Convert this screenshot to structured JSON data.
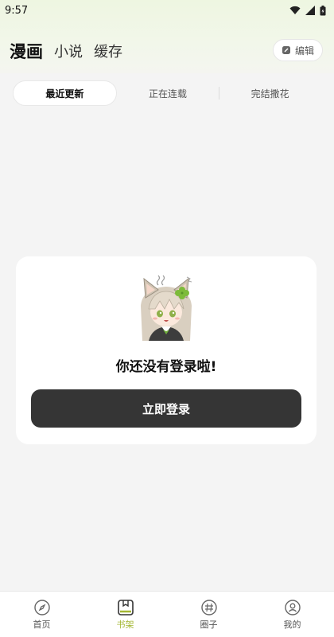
{
  "status_bar": {
    "time": "9:57"
  },
  "header": {
    "tabs": [
      {
        "label": "漫画",
        "active": true
      },
      {
        "label": "小说",
        "active": false
      },
      {
        "label": "缓存",
        "active": false
      }
    ],
    "edit_label": "编辑"
  },
  "subtabs": [
    {
      "label": "最近更新",
      "active": true
    },
    {
      "label": "正在连载",
      "active": false
    },
    {
      "label": "完结撒花",
      "active": false
    }
  ],
  "empty_state": {
    "message": "你还没有登录啦!",
    "login_button": "立即登录"
  },
  "bottom_nav": [
    {
      "label": "首页",
      "icon": "compass-icon",
      "active": false
    },
    {
      "label": "书架",
      "icon": "bookshelf-icon",
      "active": true
    },
    {
      "label": "圈子",
      "icon": "hashtag-icon",
      "active": false
    },
    {
      "label": "我的",
      "icon": "profile-icon",
      "active": false
    }
  ],
  "colors": {
    "accent": "#a4b733",
    "button_dark": "#353535",
    "header_tint": "#eef6e1"
  }
}
